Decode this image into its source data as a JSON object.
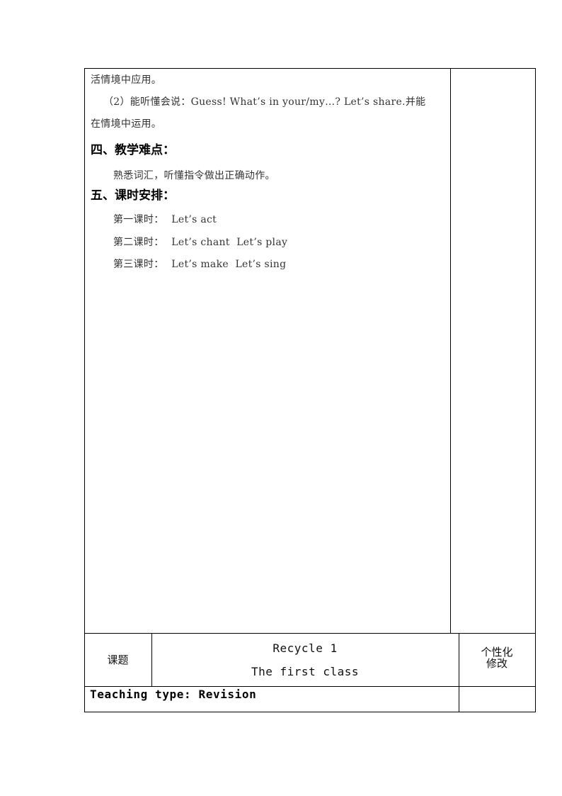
{
  "upper_section": {
    "lines": [
      "活情境中应用。",
      "（2）能听懂会说：Guess! What’s in your/my…? Let’s share.并能",
      "在情境中运用。"
    ],
    "heading_difficulties": "四、教学难点：",
    "difficulties_text": "熟悉词汇，听懂指令做出正确动作。",
    "heading_schedule": "五、课时安排：",
    "schedule": [
      {
        "label": "第一课时：",
        "content": "Let’s act"
      },
      {
        "label": "第二课时：",
        "content": "Let’s chant  Let’s play"
      },
      {
        "label": "第三课时：",
        "content": "Let’s make  Let’s sing"
      }
    ]
  },
  "lesson_table": {
    "label_cell": "课题",
    "title_line1": "Recycle 1",
    "title_line2": "The first class",
    "side_cell_line1": "个性化",
    "side_cell_line2": "修改",
    "teaching_type": "Teaching type: Revision"
  }
}
